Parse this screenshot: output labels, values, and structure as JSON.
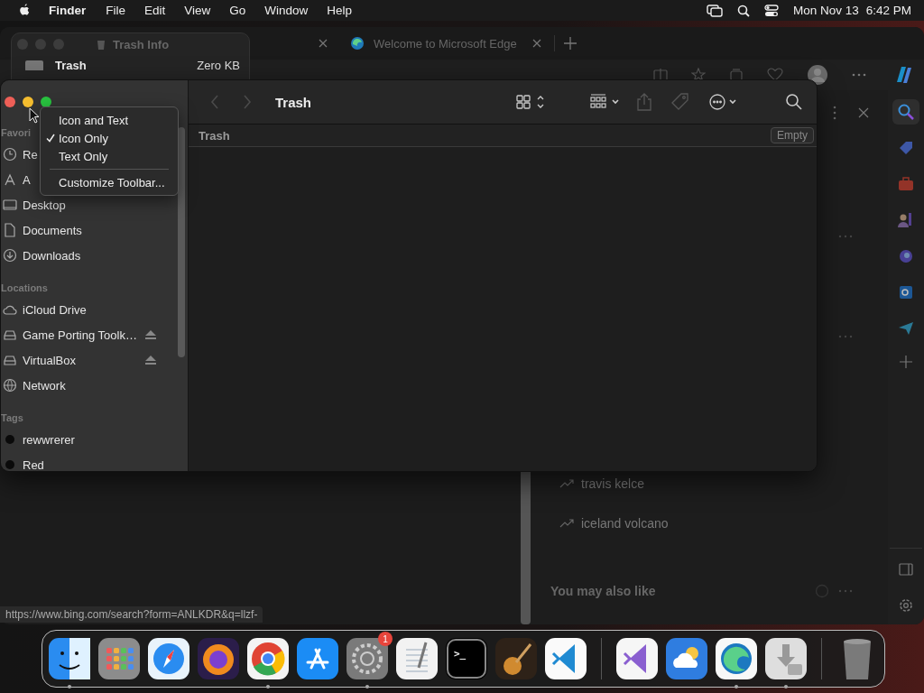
{
  "menu_bar": {
    "app": "Finder",
    "menus": [
      "File",
      "Edit",
      "View",
      "Go",
      "Window",
      "Help"
    ],
    "date": "Mon Nov 13",
    "time": "6:42 PM"
  },
  "browser": {
    "tabs": [
      {
        "title": "Welcome to Microsoft Edge",
        "selected": false
      }
    ],
    "sidebar_tools": [
      {
        "kind": "search",
        "selected": true
      },
      {
        "kind": "tag",
        "selected": false
      },
      {
        "kind": "briefcase",
        "selected": false
      },
      {
        "kind": "people",
        "selected": false
      },
      {
        "kind": "orb",
        "selected": false
      },
      {
        "kind": "mail",
        "selected": false
      },
      {
        "kind": "plane",
        "selected": false
      }
    ],
    "trending": [
      "travis kelce",
      "iceland volcano"
    ],
    "section_heading": "You may also like",
    "status_url": "https://www.bing.com/search?form=ANLKDR&q=llzf-"
  },
  "info_window": {
    "title": "Trash Info",
    "name": "Trash",
    "size": "Zero KB"
  },
  "finder": {
    "title": "Trash",
    "path": "Trash",
    "empty_button": "Empty",
    "nav": [
      {
        "kind": "back",
        "disabled": true
      },
      {
        "kind": "forward",
        "disabled": true
      }
    ],
    "tools": [
      {
        "kind": "view",
        "disabled": false
      },
      {
        "kind": "group",
        "disabled": false
      },
      {
        "kind": "share",
        "disabled": true
      },
      {
        "kind": "tag",
        "disabled": true
      },
      {
        "kind": "action",
        "disabled": false
      },
      {
        "kind": "search",
        "disabled": false
      }
    ],
    "sidebar": [
      {
        "heading": "Favori",
        "items": [
          {
            "label": "Re",
            "kind": "clock",
            "ejectable": false
          },
          {
            "label": "A",
            "kind": "apps",
            "ejectable": false
          },
          {
            "label": "Desktop",
            "kind": "desktop",
            "ejectable": false
          },
          {
            "label": "Documents",
            "kind": "document",
            "ejectable": false
          },
          {
            "label": "Downloads",
            "kind": "download",
            "ejectable": false
          }
        ]
      },
      {
        "heading": "Locations",
        "items": [
          {
            "label": "iCloud Drive",
            "kind": "cloud",
            "ejectable": false
          },
          {
            "label": "Game Porting Toolk…",
            "kind": "drive",
            "ejectable": true
          },
          {
            "label": "VirtualBox",
            "kind": "drive",
            "ejectable": true
          },
          {
            "label": "Network",
            "kind": "globe",
            "ejectable": false
          }
        ]
      },
      {
        "heading": "Tags",
        "items": [
          {
            "label": "rewwrerer",
            "kind": "tag",
            "ejectable": false
          },
          {
            "label": "Red",
            "kind": "tag",
            "ejectable": false
          }
        ]
      }
    ]
  },
  "context_menu": {
    "items": [
      {
        "label": "Icon and Text",
        "checked": false
      },
      {
        "label": "Icon Only",
        "checked": true
      },
      {
        "label": "Text Only",
        "checked": false
      }
    ],
    "footer": "Customize Toolbar..."
  },
  "dock": {
    "sections": [
      {
        "apps": [
          {
            "kind": "finder",
            "color": "#2a8cf0",
            "running": true
          },
          {
            "kind": "grid",
            "color": "#8c8c8c",
            "running": false
          },
          {
            "kind": "compass",
            "color": "#e9f3fb",
            "running": false
          },
          {
            "kind": "fox",
            "color": "#2b1d4a",
            "running": false
          },
          {
            "kind": "chrome",
            "color": "#f4f4f4",
            "running": true
          },
          {
            "kind": "appstore",
            "color": "#1b8cf5",
            "running": false
          },
          {
            "kind": "gear",
            "color": "#7a7a7a",
            "running": true,
            "badge": "1"
          },
          {
            "kind": "notepad",
            "color": "#f2f2f2",
            "running": false
          },
          {
            "kind": "terminal",
            "color": "#000000",
            "running": false,
            "label": ">_"
          },
          {
            "kind": "guitar",
            "color": "#2e2218",
            "running": false
          },
          {
            "kind": "code",
            "color": "#fafafa",
            "running": false
          }
        ]
      },
      {
        "apps": [
          {
            "kind": "vs",
            "color": "#f6f6f6",
            "running": false
          },
          {
            "kind": "weather",
            "color": "#2f7de0",
            "running": false
          },
          {
            "kind": "edge",
            "color": "#f8f8f8",
            "running": true
          },
          {
            "kind": "installer",
            "color": "#dedede",
            "running": true
          }
        ]
      },
      {
        "apps": [
          {
            "kind": "trash",
            "color": "#7a7a7a",
            "running": false
          }
        ]
      }
    ]
  }
}
